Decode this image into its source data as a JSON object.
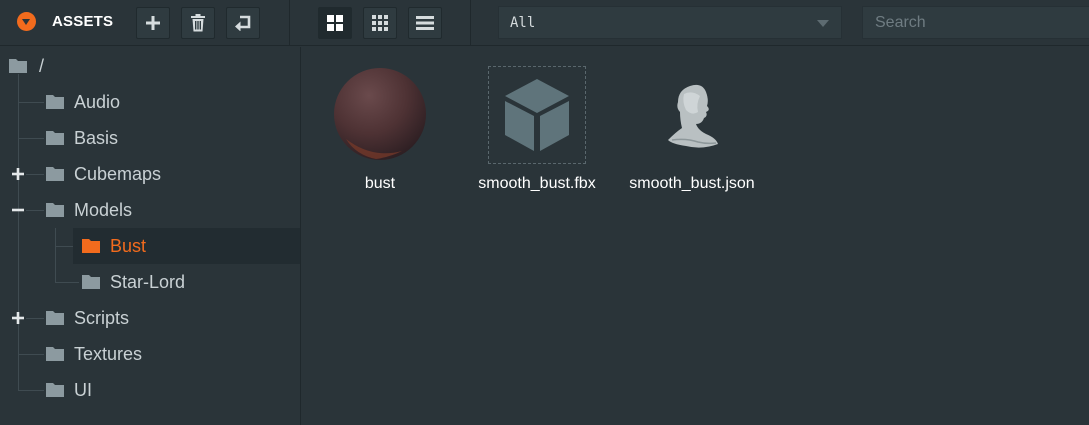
{
  "toolbar": {
    "title": "ASSETS",
    "filter": {
      "value": "All"
    },
    "search": {
      "placeholder": "Search"
    }
  },
  "tree": {
    "root": "/",
    "items": [
      {
        "label": "Audio",
        "expander": ""
      },
      {
        "label": "Basis",
        "expander": ""
      },
      {
        "label": "Cubemaps",
        "expander": "+"
      },
      {
        "label": "Models",
        "expander": "−"
      },
      {
        "label": "Bust",
        "expander": "",
        "selected": true
      },
      {
        "label": "Star-Lord",
        "expander": ""
      },
      {
        "label": "Scripts",
        "expander": "+"
      },
      {
        "label": "Textures",
        "expander": ""
      },
      {
        "label": "UI",
        "expander": ""
      }
    ]
  },
  "assets": [
    {
      "name": "bust",
      "icon": "material-sphere-icon"
    },
    {
      "name": "smooth_bust.fbx",
      "icon": "model-cube-icon"
    },
    {
      "name": "smooth_bust.json",
      "icon": "bust-preview-icon"
    }
  ],
  "colors": {
    "accent": "#f26b1d",
    "background": "#2a3439",
    "folder": "#8c9aa0"
  }
}
